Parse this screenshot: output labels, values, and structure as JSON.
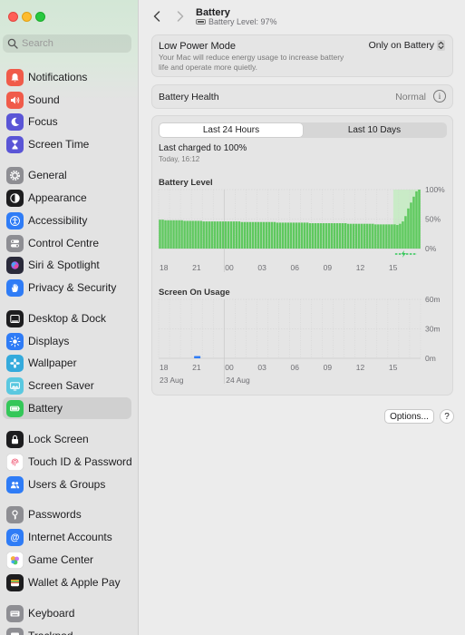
{
  "window": {
    "title": "Battery",
    "subtitle": "Battery Level: 97%"
  },
  "search": {
    "placeholder": "Search"
  },
  "sidebar": {
    "items": [
      {
        "label": "Notifications",
        "icon": "bell-icon",
        "color": "#f05b4a"
      },
      {
        "label": "Sound",
        "icon": "speaker-icon",
        "color": "#f05b4a"
      },
      {
        "label": "Focus",
        "icon": "moon-icon",
        "color": "#5a55d6"
      },
      {
        "label": "Screen Time",
        "icon": "hourglass-icon",
        "color": "#5a55d6"
      },
      {
        "label": "General",
        "icon": "gear-icon",
        "color": "#8e8e93"
      },
      {
        "label": "Appearance",
        "icon": "appearance-icon",
        "color": "#1d1d1f"
      },
      {
        "label": "Accessibility",
        "icon": "accessibility-icon",
        "color": "#2f7cf6"
      },
      {
        "label": "Control Centre",
        "icon": "toggle-icon",
        "color": "#8e8e93"
      },
      {
        "label": "Siri & Spotlight",
        "icon": "siri-icon",
        "color": "#2a2a3a"
      },
      {
        "label": "Privacy & Security",
        "icon": "hand-icon",
        "color": "#2f7cf6"
      },
      {
        "label": "Desktop & Dock",
        "icon": "dock-icon",
        "color": "#1d1d1f"
      },
      {
        "label": "Displays",
        "icon": "sun-icon",
        "color": "#2f7cf6"
      },
      {
        "label": "Wallpaper",
        "icon": "flower-icon",
        "color": "#34aadc"
      },
      {
        "label": "Screen Saver",
        "icon": "screensaver-icon",
        "color": "#5ac8e0"
      },
      {
        "label": "Battery",
        "icon": "battery-icon",
        "color": "#34c759"
      },
      {
        "label": "Lock Screen",
        "icon": "lock-icon",
        "color": "#1d1d1f"
      },
      {
        "label": "Touch ID & Password",
        "icon": "fingerprint-icon",
        "color": "#ffffff"
      },
      {
        "label": "Users & Groups",
        "icon": "users-icon",
        "color": "#2f7cf6"
      },
      {
        "label": "Passwords",
        "icon": "key-icon",
        "color": "#8e8e93"
      },
      {
        "label": "Internet Accounts",
        "icon": "at-icon",
        "color": "#2f7cf6"
      },
      {
        "label": "Game Center",
        "icon": "gamecenter-icon",
        "color": "#ffffff"
      },
      {
        "label": "Wallet & Apple Pay",
        "icon": "wallet-icon",
        "color": "#1d1d1f"
      },
      {
        "label": "Keyboard",
        "icon": "keyboard-icon",
        "color": "#8e8e93"
      },
      {
        "label": "Trackpad",
        "icon": "trackpad-icon",
        "color": "#8e8e93"
      }
    ],
    "selected": "Battery"
  },
  "low_power": {
    "title": "Low Power Mode",
    "description": "Your Mac will reduce energy usage to increase battery life and operate more quietly.",
    "value": "Only on Battery"
  },
  "health": {
    "label": "Battery Health",
    "value": "Normal"
  },
  "usage": {
    "tabs": [
      {
        "label": "Last 24 Hours",
        "active": true
      },
      {
        "label": "Last 10 Days",
        "active": false
      }
    ],
    "last_charged": "Last charged to 100%",
    "last_charged_time": "Today, 16:12"
  },
  "chart_data": [
    {
      "type": "bar",
      "title": "Battery Level",
      "x_ticks": [
        "18",
        "21",
        "00",
        "03",
        "06",
        "09",
        "12",
        "15"
      ],
      "y_ticks": [
        "100%",
        "50%",
        "0%"
      ],
      "ylim": [
        0,
        100
      ],
      "values": [
        49,
        49,
        48,
        48,
        48,
        48,
        48,
        48,
        48,
        47,
        47,
        47,
        47,
        47,
        47,
        47,
        46,
        46,
        46,
        46,
        46,
        46,
        46,
        46,
        46,
        46,
        46,
        46,
        46,
        46,
        45,
        45,
        45,
        45,
        45,
        45,
        45,
        45,
        45,
        45,
        45,
        45,
        45,
        44,
        44,
        44,
        44,
        44,
        44,
        44,
        44,
        44,
        44,
        44,
        44,
        43,
        43,
        43,
        43,
        43,
        43,
        43,
        43,
        43,
        43,
        43,
        43,
        43,
        43,
        42,
        42,
        42,
        42,
        42,
        42,
        42,
        42,
        42,
        42,
        41,
        41,
        41,
        41,
        41,
        41,
        41,
        41,
        40,
        42,
        46,
        55,
        68,
        78,
        88,
        97,
        100
      ],
      "charging_start_index": 86,
      "colors": {
        "bar": "#5fc95f",
        "charging_band": "#c9ebc7",
        "charging_marker": "#34c759"
      }
    },
    {
      "type": "bar",
      "title": "Screen On Usage",
      "x_ticks": [
        "18",
        "21",
        "00",
        "03",
        "06",
        "09",
        "12",
        "15"
      ],
      "date_labels": [
        "23 Aug",
        "24 Aug"
      ],
      "y_ticks": [
        "60m",
        "30m",
        "0m"
      ],
      "ylim": [
        0,
        60
      ],
      "values": [
        0,
        0,
        0,
        2,
        0,
        0,
        0,
        0,
        0,
        0,
        0,
        0,
        0,
        0,
        0,
        0,
        0,
        0,
        0,
        0,
        0,
        0,
        0,
        0
      ],
      "colors": {
        "bar": "#2f7cf6"
      }
    }
  ],
  "buttons": {
    "options": "Options...",
    "help": "?"
  }
}
